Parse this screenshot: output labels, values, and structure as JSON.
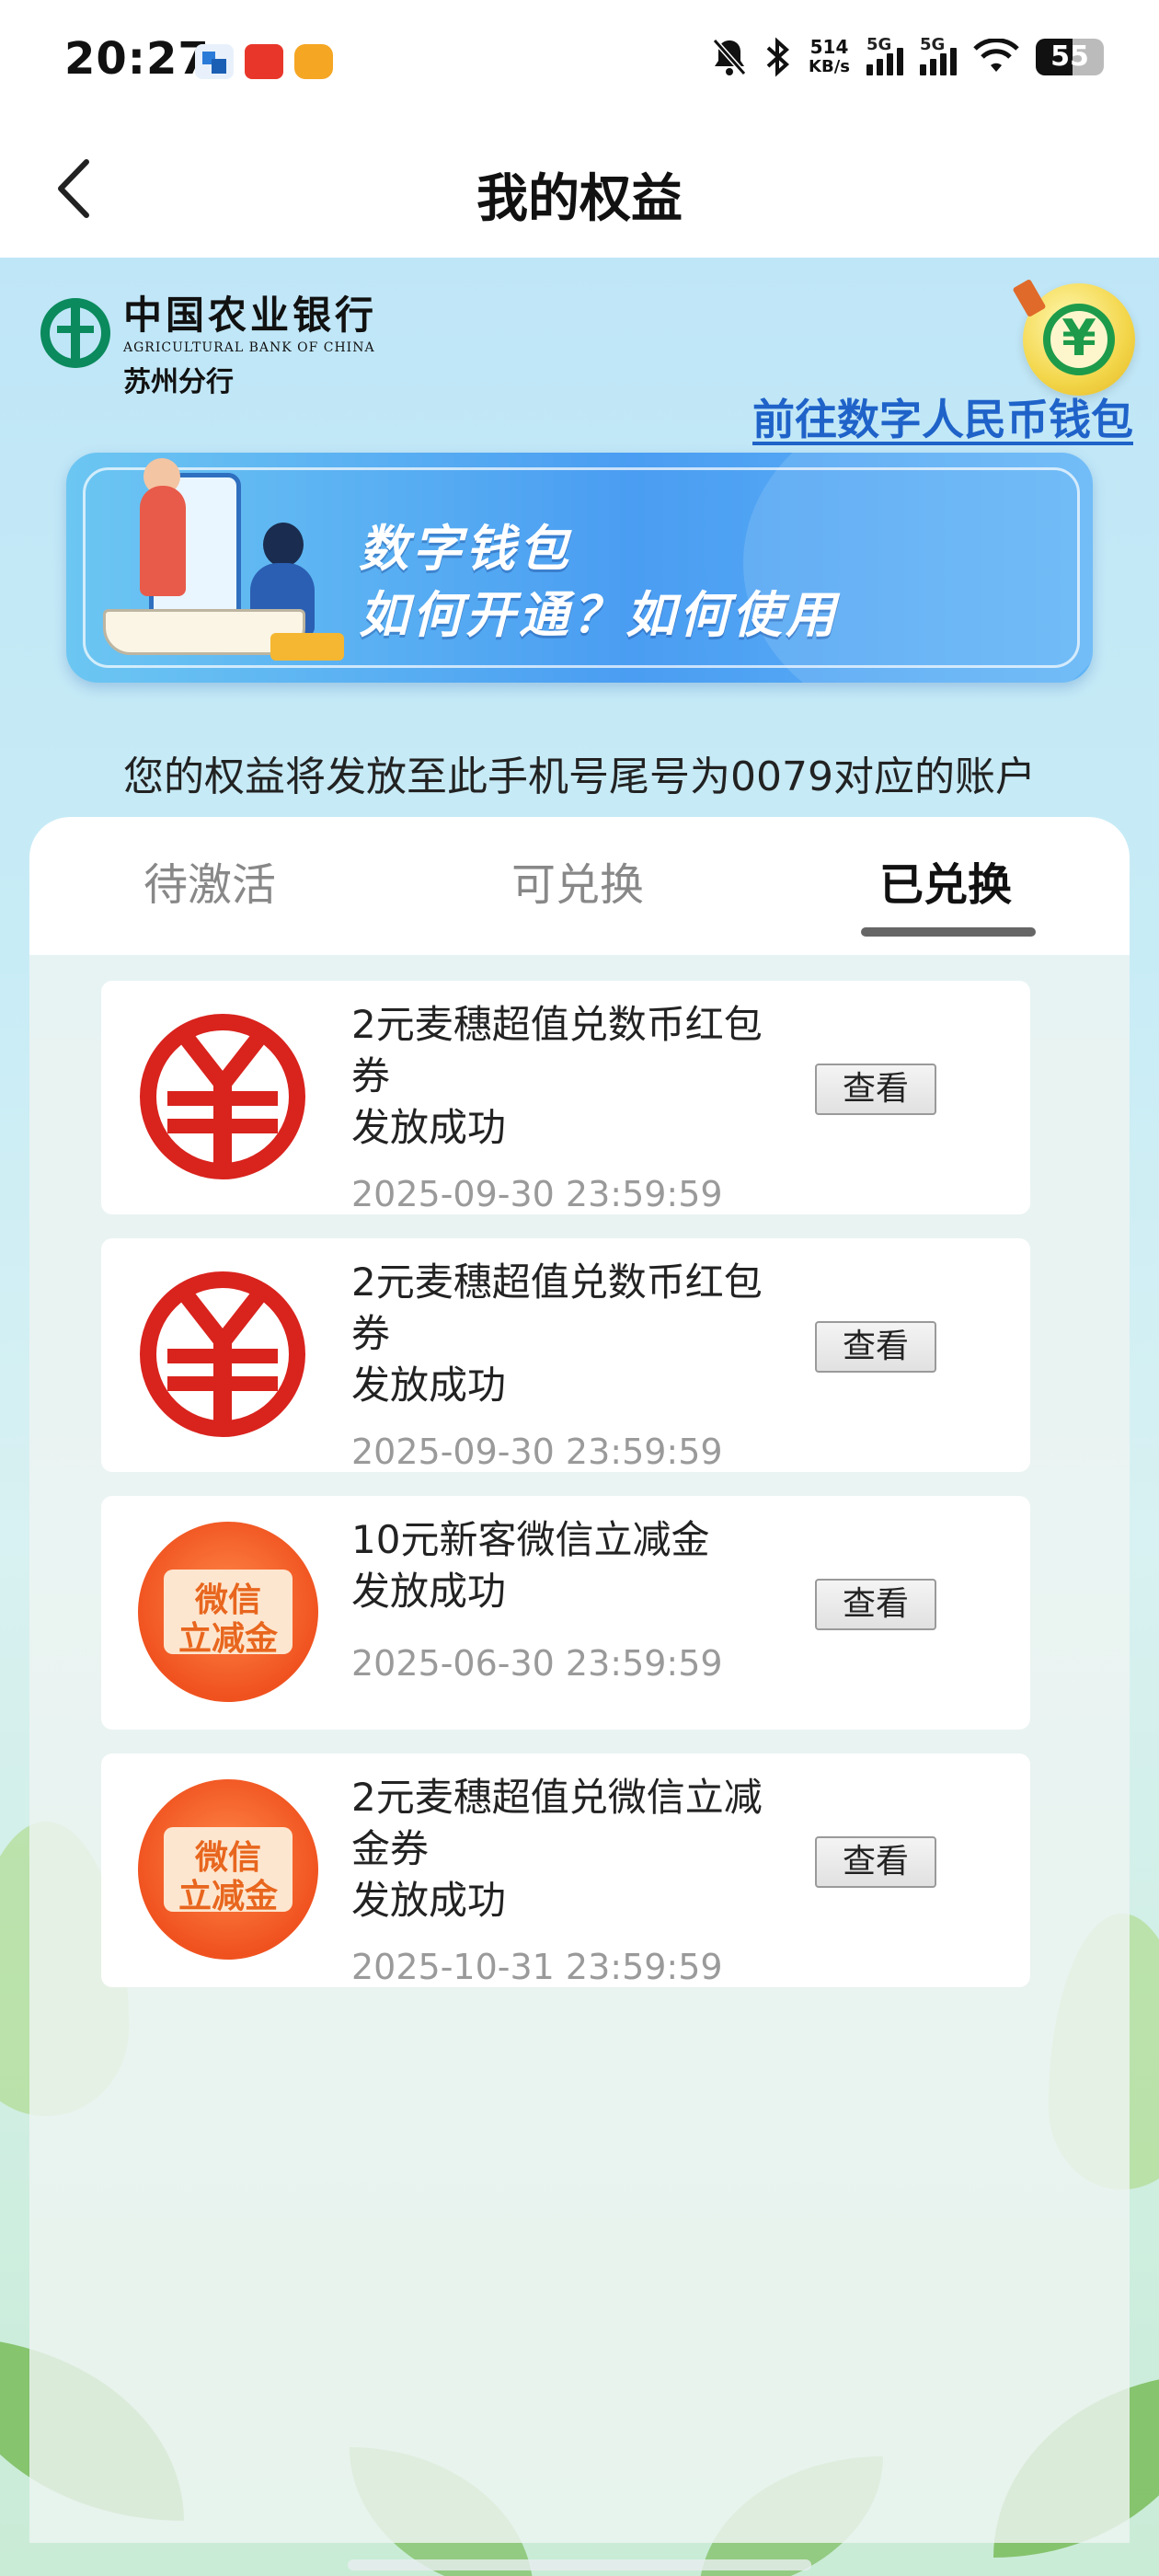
{
  "status_bar": {
    "time": "20:27",
    "net_speed_value": "514",
    "net_speed_unit": "KB/s",
    "signal1_label": "5G",
    "signal2_label": "5G",
    "battery": "55"
  },
  "header": {
    "title": "我的权益",
    "back_icon": "chevron-left-icon"
  },
  "bank": {
    "name_cn": "中国农业银行",
    "name_en": "AGRICULTURAL BANK OF CHINA",
    "branch": "苏州分行"
  },
  "wallet_link": "前往数字人民币钱包",
  "banner": {
    "line1": "数字钱包",
    "line2": "如何开通？如何使用"
  },
  "notice": "您的权益将发放至此手机号尾号为0079对应的账户",
  "tabs": [
    {
      "label": "待激活",
      "active": false
    },
    {
      "label": "可兑换",
      "active": false
    },
    {
      "label": "已兑换",
      "active": true
    }
  ],
  "items": [
    {
      "icon": "digital-yuan-icon",
      "name": "2元麦穗超值兑数币红包券",
      "status": "发放成功",
      "date": "2025-09-30 23:59:59",
      "button": "查看"
    },
    {
      "icon": "digital-yuan-icon",
      "name": "2元麦穗超值兑数币红包券",
      "status": "发放成功",
      "date": "2025-09-30 23:59:59",
      "button": "查看"
    },
    {
      "icon": "wechat-discount-icon",
      "name": "10元新客微信立减金",
      "status": "发放成功",
      "date": "2025-06-30 23:59:59",
      "button": "查看"
    },
    {
      "icon": "wechat-discount-icon",
      "name": "2元麦穗超值兑微信立减金券",
      "status": "发放成功",
      "date": "2025-10-31 23:59:59",
      "button": "查看"
    }
  ],
  "wx_logo_text": {
    "line1": "微信",
    "line2": "立减金"
  },
  "colors": {
    "brand_green": "#0a8a5d",
    "link_blue": "#1f63c9",
    "yuan_red": "#d9231d",
    "wechat_orange": "#f0521f"
  }
}
